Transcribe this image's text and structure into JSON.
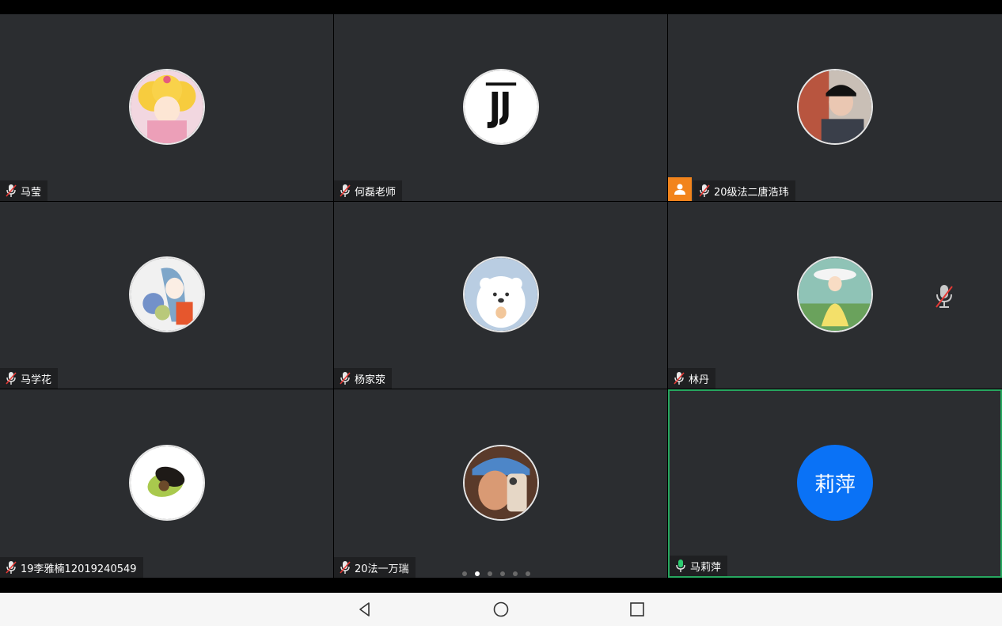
{
  "participants": [
    {
      "name": "马莹"
    },
    {
      "name": "何磊老师"
    },
    {
      "name": "20级法二唐浩玮"
    },
    {
      "name": "马学花"
    },
    {
      "name": "杨家荥"
    },
    {
      "name": "林丹"
    },
    {
      "name": "19李雅楠12019240549"
    },
    {
      "name": "20法一万瑞"
    },
    {
      "name": "马莉萍",
      "initials": "莉萍"
    }
  ],
  "avatar_colors": {
    "initials_bg": "#0a72f6",
    "active_border": "#27a75f",
    "host_badge": "#f2841c"
  },
  "pager": {
    "pages": 6,
    "current": 2
  },
  "navbar": {
    "buttons": [
      "back-icon",
      "home-icon",
      "recents-icon"
    ]
  }
}
